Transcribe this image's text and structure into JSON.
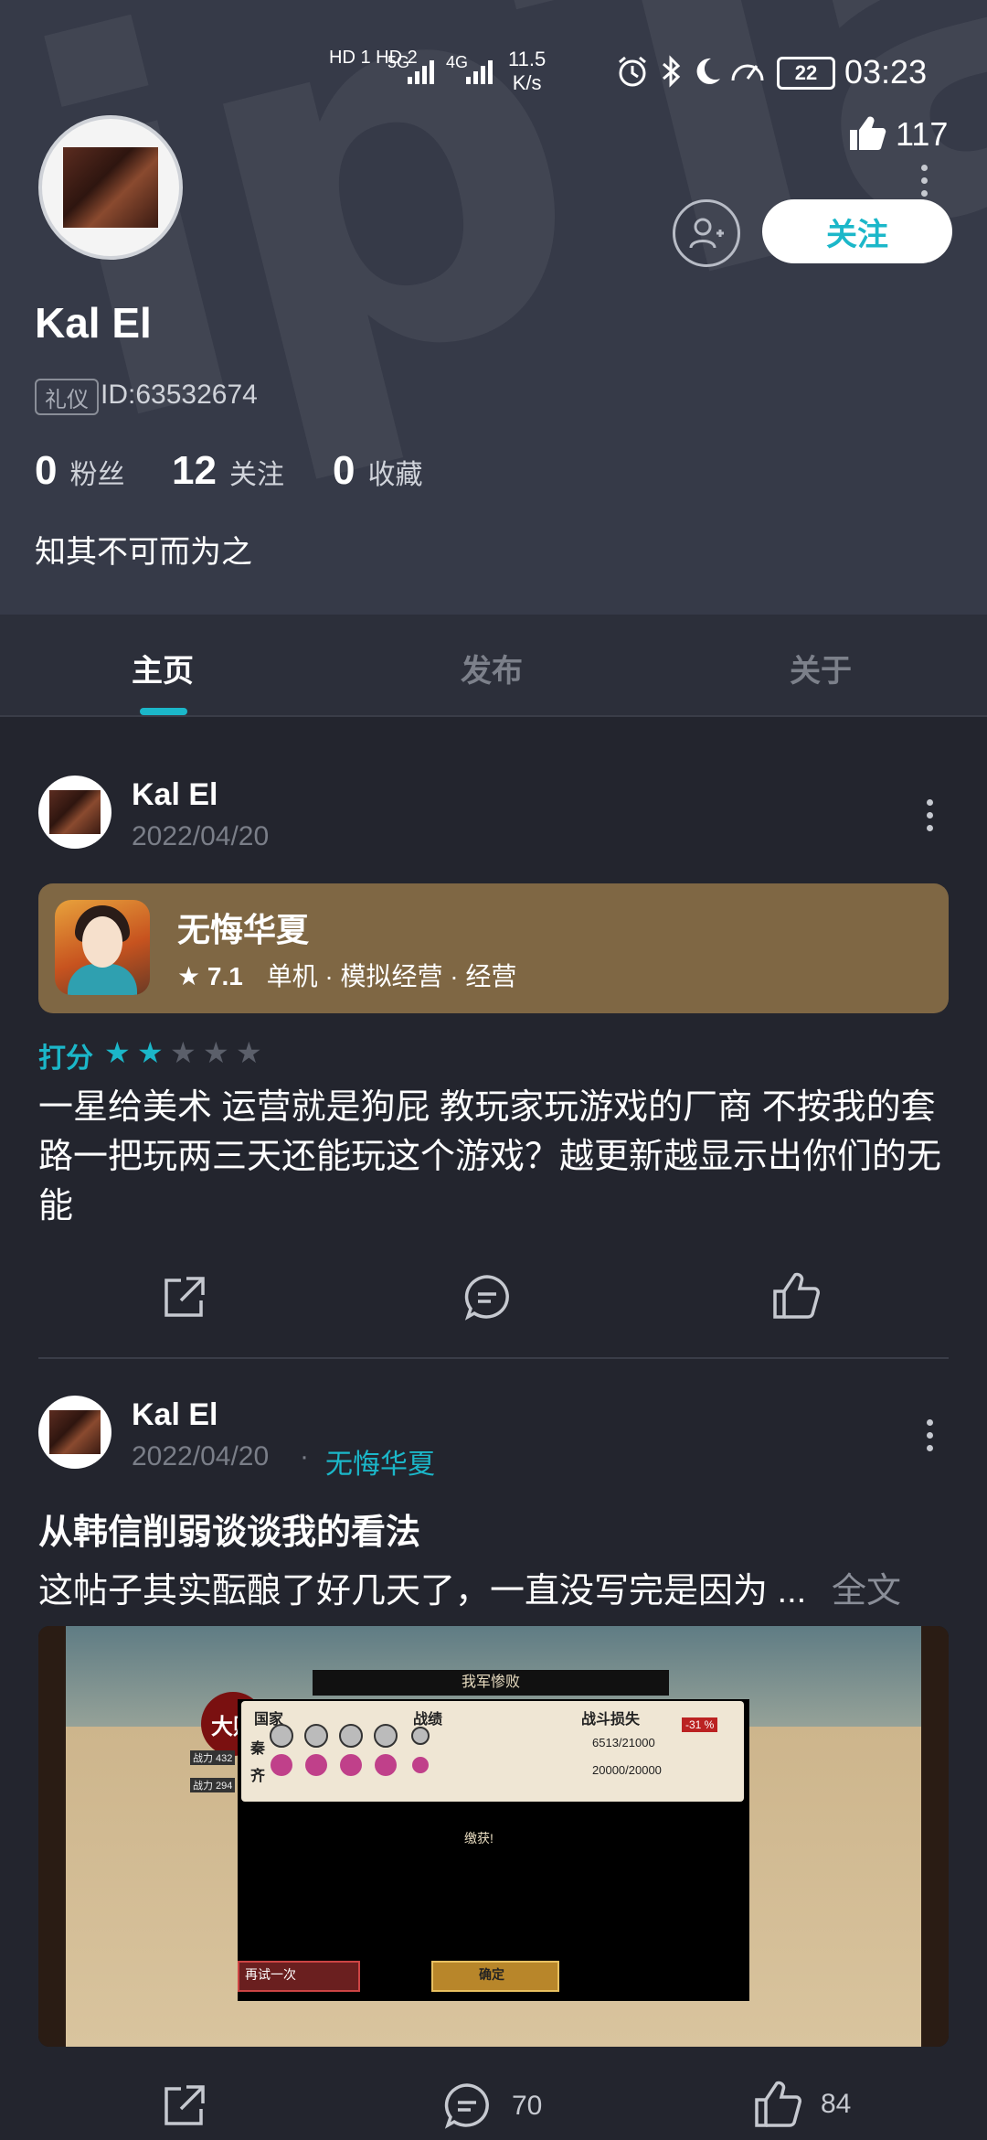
{
  "status_bar": {
    "network_left": "HD 1 HD 2",
    "signal_5g": "5G",
    "signal_4g": "4G",
    "speed": "11.5",
    "speed_unit": "K/s",
    "battery": "22",
    "time": "03:23"
  },
  "profile": {
    "likes_count": "117",
    "follow_button": "关注",
    "name": "Kal El",
    "badge": "礼仪",
    "id_label": "ID:63532674",
    "fans_count": "0",
    "fans_label": "粉丝",
    "following_count": "12",
    "following_label": "关注",
    "favorites_count": "0",
    "favorites_label": "收藏",
    "bio": "知其不可而为之"
  },
  "tabs": [
    {
      "label": "主页",
      "active": true
    },
    {
      "label": "发布",
      "active": false
    },
    {
      "label": "关于",
      "active": false
    }
  ],
  "posts": [
    {
      "author": "Kal El",
      "date": "2022/04/20",
      "game": {
        "title": "无悔华夏",
        "rating": "7.1",
        "tags": "单机 · 模拟经营 · 经营"
      },
      "rate_label": "打分",
      "stars_filled": 2,
      "stars_total": 5,
      "text": "一星给美术 运营就是狗屁 教玩家玩游戏的厂商 不按我的套路一把玩两三天还能玩这个游戏？越更新越显示出你们的无能"
    },
    {
      "author": "Kal El",
      "date": "2022/04/20",
      "separator": "·",
      "game_link": "无悔华夏",
      "title": "从韩信削弱谈谈我的看法",
      "excerpt": "这帖子其实酝酿了好几天了，一直没写完是因为 ...",
      "more": "全文",
      "image": {
        "dialog_title": "我军惨败",
        "col_country": "国家",
        "col_record": "战绩",
        "col_loss": "战斗损失",
        "banner": "大败",
        "row1_country": "秦",
        "row1_power": "战力 432",
        "row1_loss": "6513/21000",
        "row1_pct": "-31 %",
        "row2_country": "齐",
        "row2_power": "战力 294",
        "row2_loss": "20000/20000",
        "captured": "缴获!",
        "retry": "再试一次",
        "confirm": "确定"
      },
      "comments": "70",
      "likes": "84"
    }
  ]
}
